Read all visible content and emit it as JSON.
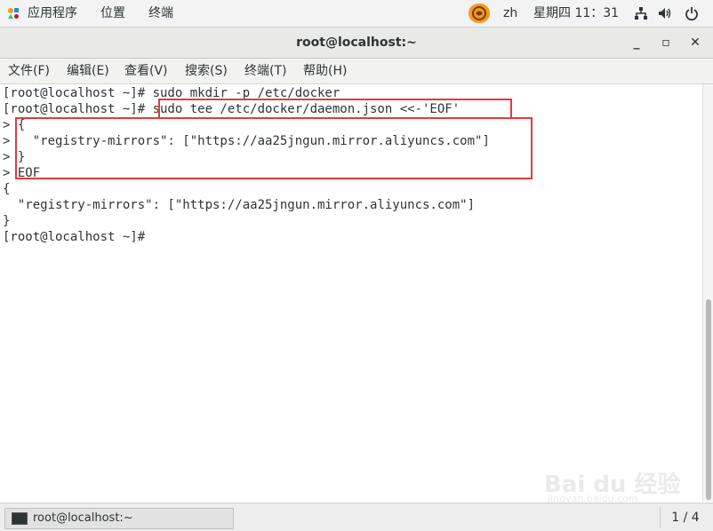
{
  "top_bar": {
    "apps_label": "应用程序",
    "places_label": "位置",
    "terminal_label": "终端",
    "input_method": "zh",
    "datetime": "星期四 11：31"
  },
  "window": {
    "title": "root@localhost:~",
    "minimize": "_",
    "maximize": "▫",
    "close": "✕"
  },
  "menu": {
    "file": "文件(F)",
    "edit": "编辑(E)",
    "view": "查看(V)",
    "search": "搜索(S)",
    "terminal": "终端(T)",
    "help": "帮助(H)"
  },
  "terminal": {
    "lines": [
      "[root@localhost ~]# sudo mkdir -p /etc/docker",
      "[root@localhost ~]# sudo tee /etc/docker/daemon.json <<-'EOF'",
      "> {",
      ">   \"registry-mirrors\": [\"https://aa25jngun.mirror.aliyuncs.com\"]",
      "> }",
      "> EOF",
      "{",
      "  \"registry-mirrors\": [\"https://aa25jngun.mirror.aliyuncs.com\"]",
      "}",
      "[root@localhost ~]# "
    ]
  },
  "taskbar": {
    "window_label": "root@localhost:~",
    "workspace": "1 / 4"
  },
  "watermark": {
    "main": "Bai du 经验",
    "sub": "jingyan.baidu.com"
  },
  "colors": {
    "highlight": "#e33a3a",
    "panel": "#f3f3f3",
    "text": "#2e3436"
  }
}
